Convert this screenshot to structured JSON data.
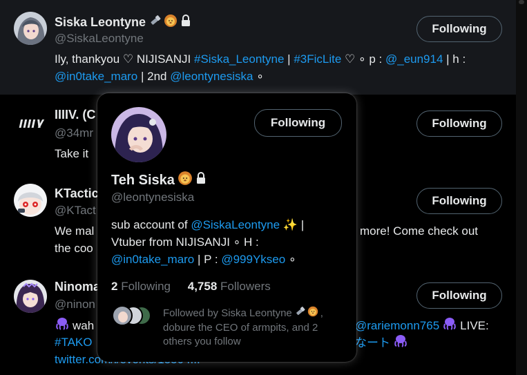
{
  "rows": [
    {
      "name": "Siska Leontyne",
      "handle": "@SiskaLeontyne",
      "follow_label": "Following",
      "bio_line1": [
        {
          "t": "Ily, thankyou ♡ NIJISANJI ",
          "link": false
        },
        {
          "t": "#Siska_Leontyne",
          "link": true
        },
        {
          "t": " | ",
          "link": false
        },
        {
          "t": "#3FicLite",
          "link": true
        },
        {
          "t": " ♡ ∘ p : ",
          "link": false
        },
        {
          "t": "@_eun914",
          "link": true
        },
        {
          "t": " | h :",
          "link": false
        }
      ],
      "bio_line2": [
        {
          "t": "@in0take_maro",
          "link": true
        },
        {
          "t": " | 2nd ",
          "link": false
        },
        {
          "t": "@leontynesiska",
          "link": true
        },
        {
          "t": " ∘",
          "link": false
        }
      ]
    },
    {
      "name": "IIIIV. (C",
      "handle": "@34mr",
      "follow_label": "Following",
      "bio_line1": "Take it"
    },
    {
      "name": "KTactic",
      "handle": "@KTact",
      "follow_label": "Following",
      "bio_line1_left": "We mal",
      "bio_line1_right": "more! Come check out",
      "bio_line2_left": "the coo"
    },
    {
      "name": "Ninoma",
      "handle": "@ninon",
      "follow_label": "Following",
      "bio_line1_left": "wah",
      "bio_line1_right_link": "@rariemonn765",
      "bio_line1_right_text": " LIVE:",
      "bio_line2_left_link": "#TAKO",
      "bio_line2_right": "なート",
      "bio_line3_link": "twitter.com/i/events/15504..."
    }
  ],
  "popup": {
    "name": "Teh Siska",
    "handle": "@leontynesiska",
    "follow_label": "Following",
    "bio_line1": [
      {
        "t": "sub account of ",
        "link": false
      },
      {
        "t": "@SiskaLeontyne",
        "link": true
      },
      {
        "t": " ✨ |",
        "link": false
      }
    ],
    "bio_line2": "Vtuber from NIJISANJI ∘ H :",
    "bio_line3": [
      {
        "t": "@in0take_maro",
        "link": true
      },
      {
        "t": " | P : ",
        "link": false
      },
      {
        "t": "@999Ykseo",
        "link": true
      },
      {
        "t": " ∘",
        "link": false
      }
    ],
    "following_count": "2",
    "following_label": "Following",
    "followers_count": "4,758",
    "followers_label": "Followers",
    "followed_by_line1": "Followed by Siska Leontyne",
    "followed_by_line1_end": ",",
    "followed_by_line2": "dobure the CEO of armpits, and 2",
    "followed_by_line3": "others you follow"
  },
  "colors": {
    "link": "#1d9bf0",
    "muted": "#71767b",
    "text": "#e7e9ea",
    "hover_row": "#16181c"
  }
}
